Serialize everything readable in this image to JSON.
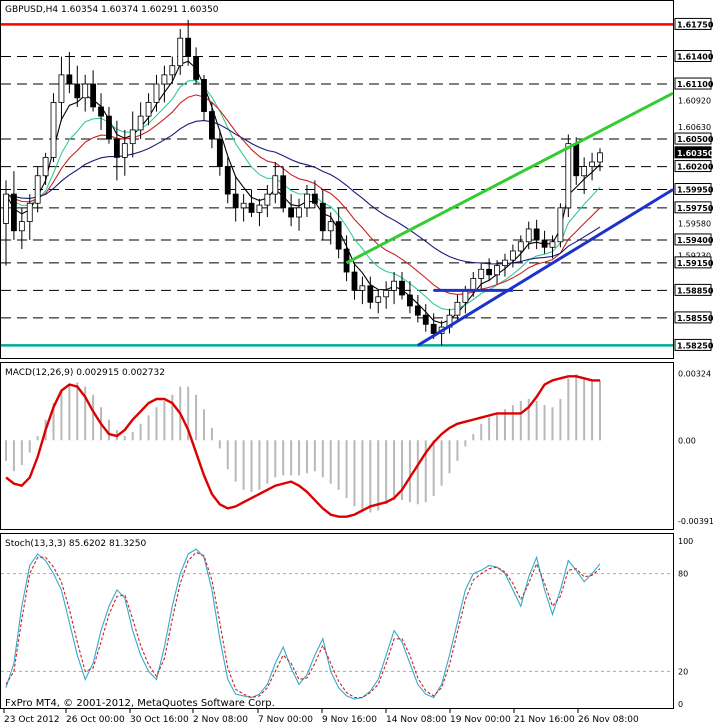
{
  "chart_data": [
    {
      "type": "candlestick",
      "title": "GBPUSD,H4  1.60354 1.60374 1.60291 1.60350",
      "ylim": [
        1.582,
        1.6182
      ],
      "y_ticks": [
        "1.61400",
        "1.61100",
        "1.60920",
        "1.60630",
        "1.60500",
        "1.60200",
        "1.59950",
        "1.59580",
        "1.59750",
        "1.59400",
        "1.59230",
        "1.59150",
        "1.58850",
        "1.58550",
        "1.58250"
      ],
      "level_labels": [
        "1.61750",
        "1.61400",
        "1.61100",
        "1.60500",
        "1.60350",
        "1.60200",
        "1.59950",
        "1.59750",
        "1.59400",
        "1.59150",
        "1.58850",
        "1.58550",
        "1.58250"
      ],
      "current_price": "1.60350",
      "resistance_level": 1.6175,
      "support_level": 1.5825,
      "dashed_levels": [
        1.614,
        1.611,
        1.605,
        1.602,
        1.5995,
        1.5975,
        1.594,
        1.5915,
        1.5885,
        1.5855
      ],
      "ohlc": [
        [
          1.5958,
          1.6005,
          1.5912,
          1.599
        ],
        [
          1.599,
          1.6015,
          1.594,
          1.595
        ],
        [
          1.595,
          1.5975,
          1.593,
          1.596
        ],
        [
          1.596,
          1.599,
          1.594,
          1.598
        ],
        [
          1.598,
          1.602,
          1.597,
          1.601
        ],
        [
          1.601,
          1.6035,
          1.6,
          1.603
        ],
        [
          1.603,
          1.61,
          1.6025,
          1.609
        ],
        [
          1.609,
          1.614,
          1.607,
          1.612
        ],
        [
          1.612,
          1.6145,
          1.61,
          1.611
        ],
        [
          1.611,
          1.613,
          1.6085,
          1.6095
        ],
        [
          1.6095,
          1.612,
          1.608,
          1.611
        ],
        [
          1.611,
          1.6125,
          1.608,
          1.6085
        ],
        [
          1.6085,
          1.61,
          1.606,
          1.6075
        ],
        [
          1.6075,
          1.6085,
          1.6045,
          1.605
        ],
        [
          1.605,
          1.607,
          1.6005,
          1.603
        ],
        [
          1.603,
          1.606,
          1.601,
          1.6045
        ],
        [
          1.6045,
          1.608,
          1.603,
          1.606
        ],
        [
          1.606,
          1.609,
          1.605,
          1.6075
        ],
        [
          1.6075,
          1.61,
          1.6065,
          1.609
        ],
        [
          1.609,
          1.612,
          1.608,
          1.611
        ],
        [
          1.611,
          1.613,
          1.609,
          1.612
        ],
        [
          1.612,
          1.614,
          1.611,
          1.613
        ],
        [
          1.613,
          1.617,
          1.612,
          1.616
        ],
        [
          1.616,
          1.618,
          1.613,
          1.614
        ],
        [
          1.614,
          1.615,
          1.611,
          1.6115
        ],
        [
          1.6115,
          1.612,
          1.607,
          1.608
        ],
        [
          1.608,
          1.609,
          1.604,
          1.605
        ],
        [
          1.605,
          1.606,
          1.601,
          1.602
        ],
        [
          1.602,
          1.603,
          1.598,
          1.599
        ],
        [
          1.599,
          1.601,
          1.596,
          1.5975
        ],
        [
          1.5975,
          1.599,
          1.596,
          1.598
        ],
        [
          1.598,
          1.5995,
          1.5965,
          1.597
        ],
        [
          1.597,
          1.5985,
          1.5955,
          1.5978
        ],
        [
          1.5978,
          1.6,
          1.5965,
          1.599
        ],
        [
          1.599,
          1.6025,
          1.598,
          1.601
        ],
        [
          1.601,
          1.602,
          1.597,
          1.5975
        ],
        [
          1.5975,
          1.599,
          1.5955,
          1.5965
        ],
        [
          1.5965,
          1.5985,
          1.595,
          1.5975
        ],
        [
          1.5975,
          1.6,
          1.5965,
          1.599
        ],
        [
          1.599,
          1.6005,
          1.5975,
          1.598
        ],
        [
          1.598,
          1.5995,
          1.594,
          1.595
        ],
        [
          1.595,
          1.597,
          1.5935,
          1.596
        ],
        [
          1.596,
          1.5975,
          1.592,
          1.593
        ],
        [
          1.593,
          1.5945,
          1.5895,
          1.5905
        ],
        [
          1.5905,
          1.5915,
          1.5875,
          1.5885
        ],
        [
          1.5885,
          1.59,
          1.587,
          1.589
        ],
        [
          1.589,
          1.59,
          1.5865,
          1.5872
        ],
        [
          1.5872,
          1.5885,
          1.586,
          1.5878
        ],
        [
          1.5878,
          1.5895,
          1.5865,
          1.5885
        ],
        [
          1.5885,
          1.5905,
          1.587,
          1.5895
        ],
        [
          1.5895,
          1.5905,
          1.5875,
          1.588
        ],
        [
          1.588,
          1.5895,
          1.586,
          1.5868
        ],
        [
          1.5868,
          1.588,
          1.585,
          1.5858
        ],
        [
          1.5858,
          1.587,
          1.584,
          1.5848
        ],
        [
          1.5848,
          1.586,
          1.5832,
          1.5838
        ],
        [
          1.5838,
          1.5852,
          1.5825,
          1.5845
        ],
        [
          1.5845,
          1.5865,
          1.5838,
          1.5858
        ],
        [
          1.5858,
          1.588,
          1.585,
          1.5872
        ],
        [
          1.5872,
          1.589,
          1.586,
          1.5885
        ],
        [
          1.5885,
          1.5905,
          1.5878,
          1.5898
        ],
        [
          1.5898,
          1.5915,
          1.5885,
          1.5908
        ],
        [
          1.5908,
          1.592,
          1.5895,
          1.5902
        ],
        [
          1.5902,
          1.5918,
          1.5892,
          1.5912
        ],
        [
          1.5912,
          1.5925,
          1.59,
          1.5918
        ],
        [
          1.5918,
          1.5935,
          1.591,
          1.5928
        ],
        [
          1.5928,
          1.5945,
          1.5915,
          1.5938
        ],
        [
          1.5938,
          1.596,
          1.593,
          1.5952
        ],
        [
          1.5952,
          1.5962,
          1.593,
          1.594
        ],
        [
          1.594,
          1.595,
          1.5925,
          1.5932
        ],
        [
          1.5932,
          1.5945,
          1.592,
          1.5938
        ],
        [
          1.5938,
          1.598,
          1.5932,
          1.5975
        ],
        [
          1.5975,
          1.6055,
          1.5965,
          1.6045
        ],
        [
          1.6045,
          1.6052,
          1.6,
          1.601
        ],
        [
          1.601,
          1.603,
          1.599,
          1.602
        ],
        [
          1.602,
          1.6035,
          1.6005,
          1.6025
        ],
        [
          1.6025,
          1.604,
          1.6015,
          1.6035
        ]
      ],
      "moving_averages": [
        {
          "name": "black",
          "color": "#000000"
        },
        {
          "name": "green",
          "color": "#33cc99"
        },
        {
          "name": "red",
          "color": "#cc2222"
        },
        {
          "name": "navy",
          "color": "#1a1a7a"
        }
      ],
      "trendlines": [
        {
          "color": "#33cc33",
          "from": [
            43,
            1.5915
          ],
          "to": [
            "end",
            1.61
          ]
        },
        {
          "color": "#1a33cc",
          "from": [
            52,
            1.5825
          ],
          "to": [
            "end",
            1.5995
          ]
        },
        {
          "color": "#1a33cc",
          "from": [
            54,
            1.5885
          ],
          "to": [
            64,
            1.5885
          ]
        }
      ]
    },
    {
      "type": "bar+line",
      "title": "MACD(12,26,9) 0.002915 0.002732",
      "ylim": [
        -0.0042,
        0.0035
      ],
      "y_ticks": [
        "0.00324",
        "0.00",
        "-0.00391"
      ],
      "histogram": [
        -0.001,
        -0.0015,
        -0.0012,
        -0.0006,
        0.0002,
        0.001,
        0.0018,
        0.0024,
        0.0027,
        0.0028,
        0.0026,
        0.0022,
        0.0016,
        0.001,
        0.0005,
        0.0002,
        0.0004,
        0.0008,
        0.0012,
        0.0016,
        0.0019,
        0.0022,
        0.0026,
        0.0026,
        0.0022,
        0.0015,
        0.0006,
        -0.0004,
        -0.0014,
        -0.002,
        -0.0024,
        -0.0025,
        -0.0024,
        -0.0021,
        -0.0018,
        -0.0017,
        -0.0017,
        -0.0017,
        -0.0016,
        -0.0015,
        -0.0018,
        -0.0021,
        -0.0024,
        -0.0028,
        -0.0032,
        -0.0034,
        -0.0035,
        -0.0034,
        -0.0031,
        -0.0029,
        -0.0029,
        -0.003,
        -0.0031,
        -0.003,
        -0.0027,
        -0.0022,
        -0.0016,
        -0.001,
        -0.0003,
        0.0003,
        0.0008,
        0.0011,
        0.0013,
        0.0015,
        0.0017,
        0.0019,
        0.002,
        0.0019,
        0.0017,
        0.0016,
        0.002,
        0.003,
        0.0032,
        0.003,
        0.0029,
        0.0029
      ],
      "signal": [
        -0.0018,
        -0.0021,
        -0.0022,
        -0.0018,
        -0.0008,
        0.0005,
        0.0016,
        0.0024,
        0.0027,
        0.0026,
        0.0021,
        0.0014,
        0.0008,
        0.0003,
        0.0002,
        0.0005,
        0.001,
        0.0014,
        0.0018,
        0.002,
        0.002,
        0.0018,
        0.0013,
        0.0005,
        -0.0006,
        -0.0017,
        -0.0026,
        -0.0031,
        -0.0033,
        -0.0032,
        -0.003,
        -0.0028,
        -0.0026,
        -0.0024,
        -0.0022,
        -0.0021,
        -0.002,
        -0.0022,
        -0.0025,
        -0.0029,
        -0.0033,
        -0.0036,
        -0.0037,
        -0.0037,
        -0.0036,
        -0.0034,
        -0.0032,
        -0.0031,
        -0.003,
        -0.0028,
        -0.0024,
        -0.0018,
        -0.0012,
        -0.0006,
        -0.0001,
        0.0003,
        0.0006,
        0.0008,
        0.0009,
        0.001,
        0.0011,
        0.0012,
        0.0013,
        0.0013,
        0.0013,
        0.0013,
        0.0016,
        0.0021,
        0.0027,
        0.0029,
        0.003,
        0.0031,
        0.0031,
        0.003,
        0.0029,
        0.0029
      ],
      "signal_color": "#dd0000",
      "histogram_color": "#b8b8b8"
    },
    {
      "type": "line",
      "title": "Stoch(13,3,3) 85.6202 81.3250",
      "ylim": [
        0,
        100
      ],
      "y_ticks": [
        "100",
        "80",
        "20",
        "0"
      ],
      "levels": [
        80,
        20
      ],
      "series": [
        {
          "color": "#33aacc",
          "dash": "solid",
          "values": [
            10,
            25,
            60,
            85,
            92,
            88,
            80,
            70,
            50,
            30,
            15,
            25,
            45,
            60,
            70,
            65,
            45,
            30,
            20,
            15,
            35,
            60,
            80,
            92,
            95,
            90,
            70,
            40,
            15,
            6,
            5,
            4,
            6,
            12,
            25,
            35,
            22,
            12,
            18,
            30,
            40,
            20,
            10,
            5,
            3,
            4,
            8,
            15,
            30,
            45,
            38,
            25,
            12,
            6,
            4,
            12,
            30,
            50,
            70,
            80,
            82,
            85,
            84,
            80,
            70,
            60,
            78,
            90,
            70,
            55,
            70,
            88,
            82,
            75,
            80,
            86
          ]
        },
        {
          "color": "#cc2222",
          "dash": "dashed",
          "values": [
            12,
            20,
            52,
            80,
            90,
            90,
            84,
            75,
            58,
            38,
            20,
            22,
            38,
            55,
            66,
            67,
            52,
            36,
            24,
            17,
            28,
            52,
            74,
            88,
            93,
            91,
            76,
            50,
            22,
            9,
            6,
            4,
            5,
            10,
            20,
            30,
            25,
            15,
            16,
            25,
            36,
            25,
            14,
            7,
            4,
            4,
            7,
            12,
            25,
            40,
            40,
            30,
            16,
            8,
            5,
            10,
            24,
            44,
            64,
            76,
            80,
            83,
            84,
            81,
            74,
            64,
            74,
            86,
            74,
            60,
            66,
            82,
            83,
            78,
            79,
            83
          ]
        }
      ]
    }
  ],
  "x_ticks": [
    "23 Oct 2012",
    "26 Oct 00:00",
    "30 Oct 16:00",
    "2 Nov 08:00",
    "7 Nov 00:00",
    "9 Nov 16:00",
    "14 Nov 08:00",
    "19 Nov 00:00",
    "21 Nov 16:00",
    "26 Nov 08:00"
  ],
  "copyright": "FxPro MT4, © 2001-2012, MetaQuotes Software Corp.",
  "colors": {
    "border": "#000000",
    "grid_dash": "#000000",
    "price_box_bg": "#000000",
    "price_box_fg": "#ffffff",
    "resistance": "#ff0000",
    "support": "#00aa99"
  }
}
